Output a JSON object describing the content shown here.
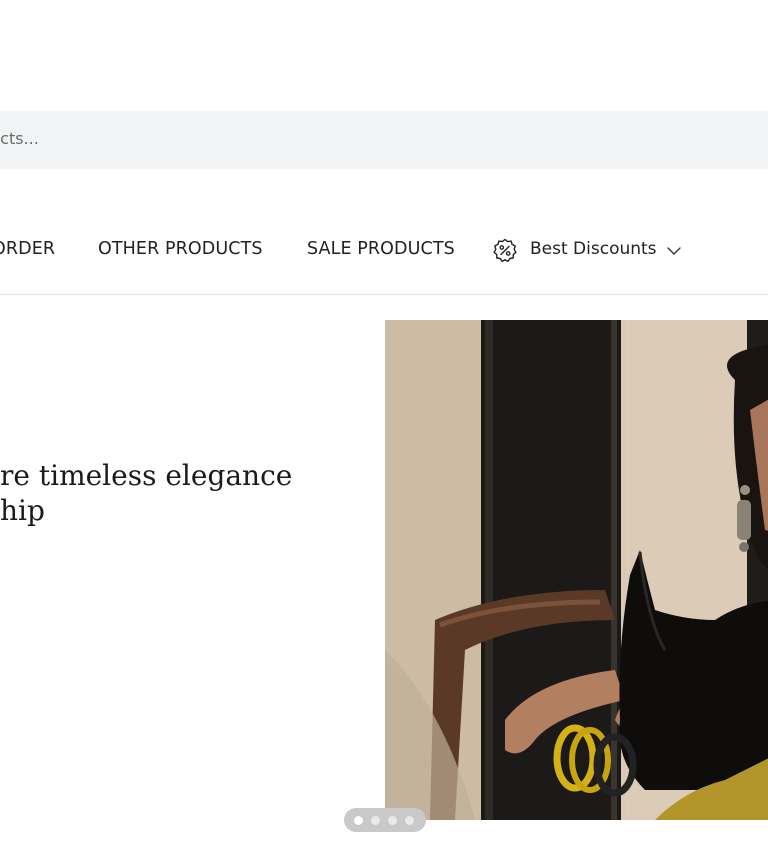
{
  "search": {
    "placeholder": "Search products...",
    "visible_text": "ucts..."
  },
  "nav": {
    "items": [
      {
        "label": "ORDER"
      },
      {
        "label": "OTHER PRODUCTS"
      },
      {
        "label": "SALE PRODUCTS"
      }
    ],
    "discount": {
      "label": "Best Discounts",
      "icon": "discount-badge-icon",
      "chevron": "chevron-down-icon"
    }
  },
  "hero": {
    "lines": [
      "re timeless elegance",
      "hip"
    ]
  },
  "carousel": {
    "slide_count": 4,
    "active_slide": 1
  },
  "colors": {
    "search_bg": "#f2f3f4",
    "text": "#1c1c1c",
    "divider": "#e2e2e2",
    "dots_bg": "#c9c9c9"
  }
}
